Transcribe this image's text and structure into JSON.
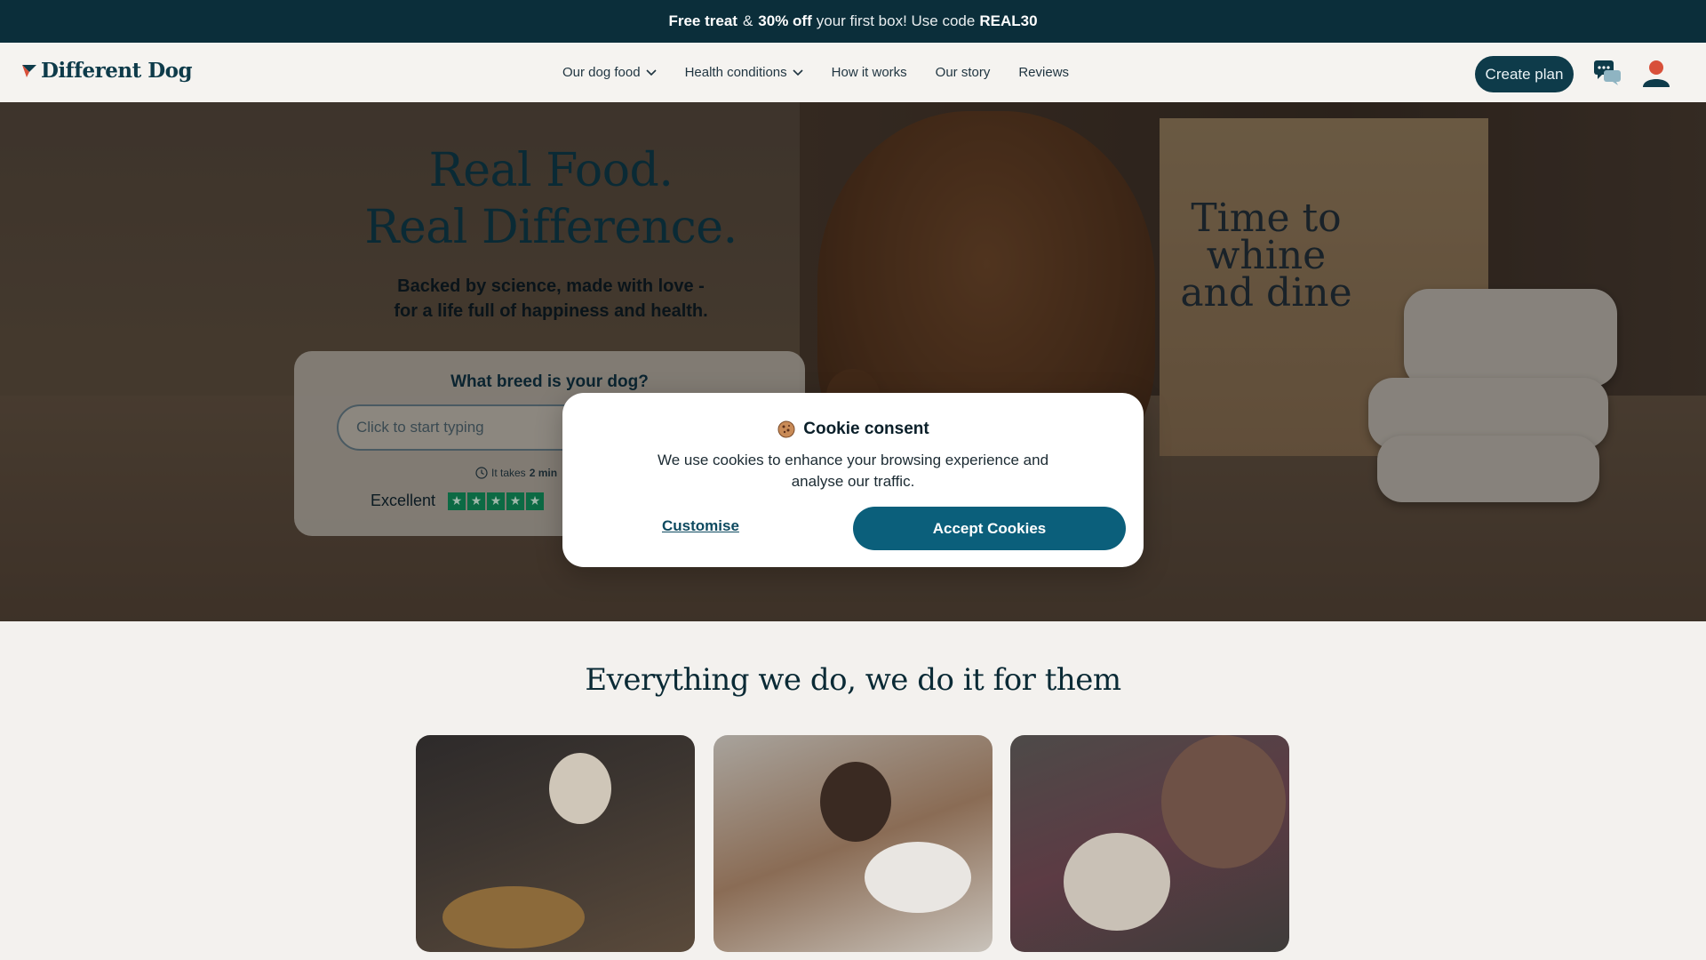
{
  "promo": {
    "part1": "Free treat",
    "amp": "&",
    "part2": "30% off",
    "part3": "your first box! Use code",
    "code": "REAL30"
  },
  "header": {
    "logo_text": "Different Dog",
    "nav": [
      {
        "label": "Our dog food",
        "has_dropdown": true
      },
      {
        "label": "Health conditions",
        "has_dropdown": true
      },
      {
        "label": "How it works",
        "has_dropdown": false
      },
      {
        "label": "Our story",
        "has_dropdown": false
      },
      {
        "label": "Reviews",
        "has_dropdown": false
      }
    ],
    "cta_label": "Create plan",
    "icons": {
      "chat": "chat-bubbles-icon",
      "account": "user-icon"
    }
  },
  "hero": {
    "title_line1": "Real Food.",
    "title_line2": "Real Difference.",
    "subtitle_line1": "Backed by science, made with love -",
    "subtitle_line2": "for a life full of happiness and health.",
    "box_text": "Time to whine and dine",
    "breed": {
      "question": "What breed is your dog?",
      "placeholder": "Click to start typing",
      "time_prefix": "It takes",
      "time_value": "2 min",
      "trust_label": "Excellent",
      "stars": 5
    }
  },
  "section": {
    "title": "Everything we do, we do it for them"
  },
  "cookie_modal": {
    "title": "Cookie consent",
    "text": "We use cookies to enhance your browsing experience and analyse our traffic.",
    "customise_label": "Customise",
    "accept_label": "Accept Cookies"
  },
  "colors": {
    "brand_dark": "#0b2e3a",
    "accent": "#0b5f7b",
    "trustpilot_green": "#0c6a44"
  }
}
